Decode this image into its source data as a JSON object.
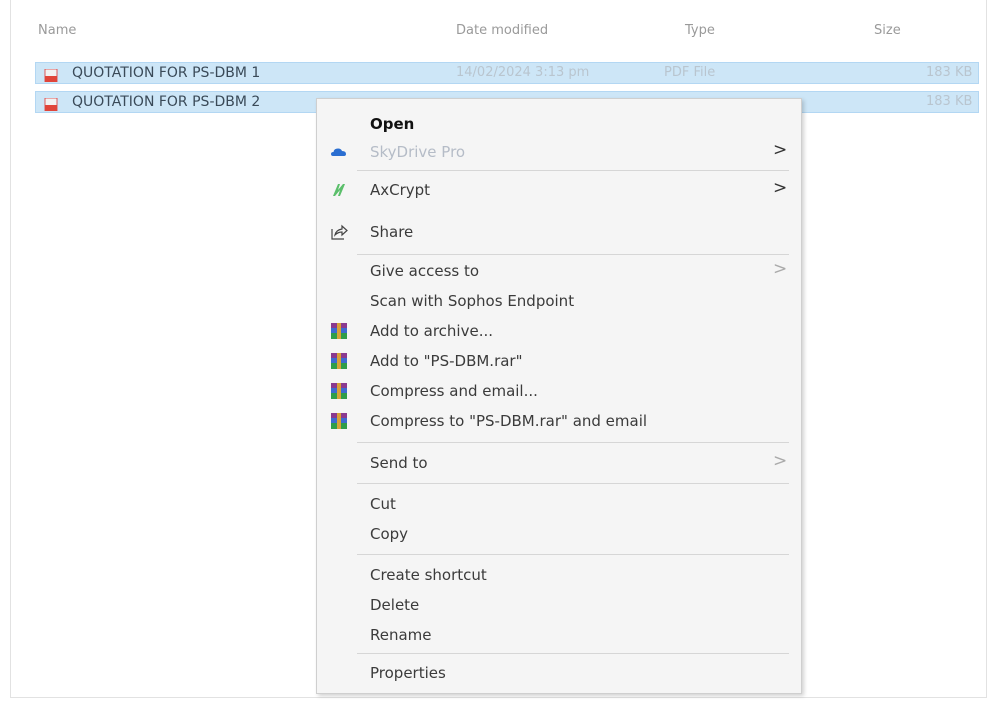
{
  "columns": {
    "name": "Name",
    "date": "Date modified",
    "type": "Type",
    "size": "Size"
  },
  "files": [
    {
      "name": "QUOTATION FOR PS-DBM 1",
      "date": "14/02/2024 3:13 pm",
      "type": "PDF File",
      "size": "183 KB"
    },
    {
      "name": "QUOTATION FOR PS-DBM 2",
      "date": "",
      "type": "",
      "size": "183 KB"
    }
  ],
  "menu": {
    "open": "Open",
    "skydrive": "SkyDrive Pro",
    "axcrypt": "AxCrypt",
    "share": "Share",
    "give_access": "Give access to",
    "scan": "Scan with Sophos Endpoint",
    "add_archive": "Add to archive...",
    "add_rar": "Add to \"PS-DBM.rar\"",
    "compress_email": "Compress and email...",
    "compress_rar_email": "Compress to \"PS-DBM.rar\" and email",
    "send_to": "Send to",
    "cut": "Cut",
    "copy": "Copy",
    "create_shortcut": "Create shortcut",
    "delete": "Delete",
    "rename": "Rename",
    "properties": "Properties",
    "submenu_arrow": ">"
  },
  "icons": {
    "pdf": "pdf-file-icon",
    "skydrive": "cloud-icon",
    "axcrypt": "axcrypt-icon",
    "share": "share-icon",
    "winrar": "winrar-icon"
  },
  "colors": {
    "selection": "#cde6f7",
    "menu_bg": "#f5f5f5",
    "cloud": "#2a6ed1",
    "axcrypt": "#5bbf6b"
  }
}
